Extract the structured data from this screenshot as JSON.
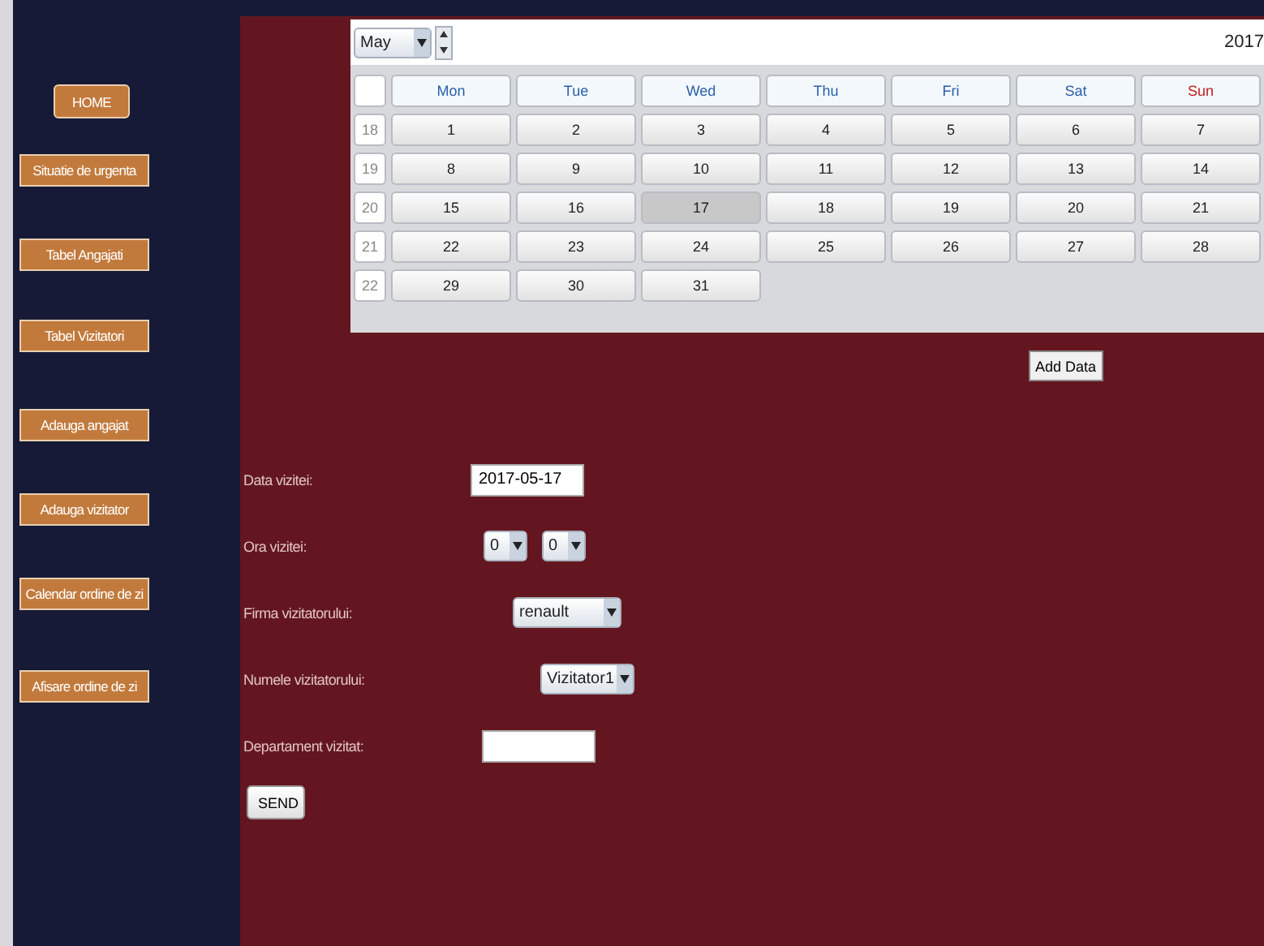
{
  "sidebar": {
    "items": [
      {
        "label": "HOME",
        "kind": "home"
      },
      {
        "label": "Situatie de urgenta",
        "kind": "nav"
      },
      {
        "label": "Tabel Angajati",
        "kind": "nav"
      },
      {
        "label": "Tabel Vizitatori",
        "kind": "nav"
      },
      {
        "label": "Adauga angajat",
        "kind": "nav"
      },
      {
        "label": "Adauga vizitator",
        "kind": "nav"
      },
      {
        "label": "Calendar ordine de zi",
        "kind": "nav"
      },
      {
        "label": "Afisare ordine de zi",
        "kind": "nav"
      }
    ]
  },
  "calendar": {
    "month": "May",
    "year": "2017",
    "weekdays": [
      {
        "label": "Mon",
        "weekend": false
      },
      {
        "label": "Tue",
        "weekend": false
      },
      {
        "label": "Wed",
        "weekend": false
      },
      {
        "label": "Thu",
        "weekend": false
      },
      {
        "label": "Fri",
        "weekend": false
      },
      {
        "label": "Sat",
        "weekend": false
      },
      {
        "label": "Sun",
        "weekend": true
      }
    ],
    "weeks": [
      {
        "number": "18",
        "days": [
          {
            "day": "1",
            "selected": false
          },
          {
            "day": "2",
            "selected": false
          },
          {
            "day": "3",
            "selected": false
          },
          {
            "day": "4",
            "selected": false
          },
          {
            "day": "5",
            "selected": false
          },
          {
            "day": "6",
            "selected": false
          },
          {
            "day": "7",
            "selected": false
          }
        ]
      },
      {
        "number": "19",
        "days": [
          {
            "day": "8",
            "selected": false
          },
          {
            "day": "9",
            "selected": false
          },
          {
            "day": "10",
            "selected": false
          },
          {
            "day": "11",
            "selected": false
          },
          {
            "day": "12",
            "selected": false
          },
          {
            "day": "13",
            "selected": false
          },
          {
            "day": "14",
            "selected": false
          }
        ]
      },
      {
        "number": "20",
        "days": [
          {
            "day": "15",
            "selected": false
          },
          {
            "day": "16",
            "selected": false
          },
          {
            "day": "17",
            "selected": true
          },
          {
            "day": "18",
            "selected": false
          },
          {
            "day": "19",
            "selected": false
          },
          {
            "day": "20",
            "selected": false
          },
          {
            "day": "21",
            "selected": false
          }
        ]
      },
      {
        "number": "21",
        "days": [
          {
            "day": "22",
            "selected": false
          },
          {
            "day": "23",
            "selected": false
          },
          {
            "day": "24",
            "selected": false
          },
          {
            "day": "25",
            "selected": false
          },
          {
            "day": "26",
            "selected": false
          },
          {
            "day": "27",
            "selected": false
          },
          {
            "day": "28",
            "selected": false
          }
        ]
      },
      {
        "number": "22",
        "days": [
          {
            "day": "29",
            "selected": false
          },
          {
            "day": "30",
            "selected": false
          },
          {
            "day": "31",
            "selected": false
          }
        ]
      }
    ]
  },
  "add_button": "Add Data",
  "form": {
    "fields": [
      {
        "label": "Data vizitei:",
        "kind": "text",
        "value": "2017-05-17"
      },
      {
        "label": "Ora vizitei:",
        "kind": "time",
        "values": [
          "0",
          "0"
        ]
      },
      {
        "label": "Firma vizitatorului:",
        "kind": "select",
        "value": "renault"
      },
      {
        "label": "Numele vizitatorului:",
        "kind": "select",
        "value": "Vizitator1"
      },
      {
        "label": "Departament vizitat:",
        "kind": "text"
      }
    ],
    "submit": "SEND"
  }
}
